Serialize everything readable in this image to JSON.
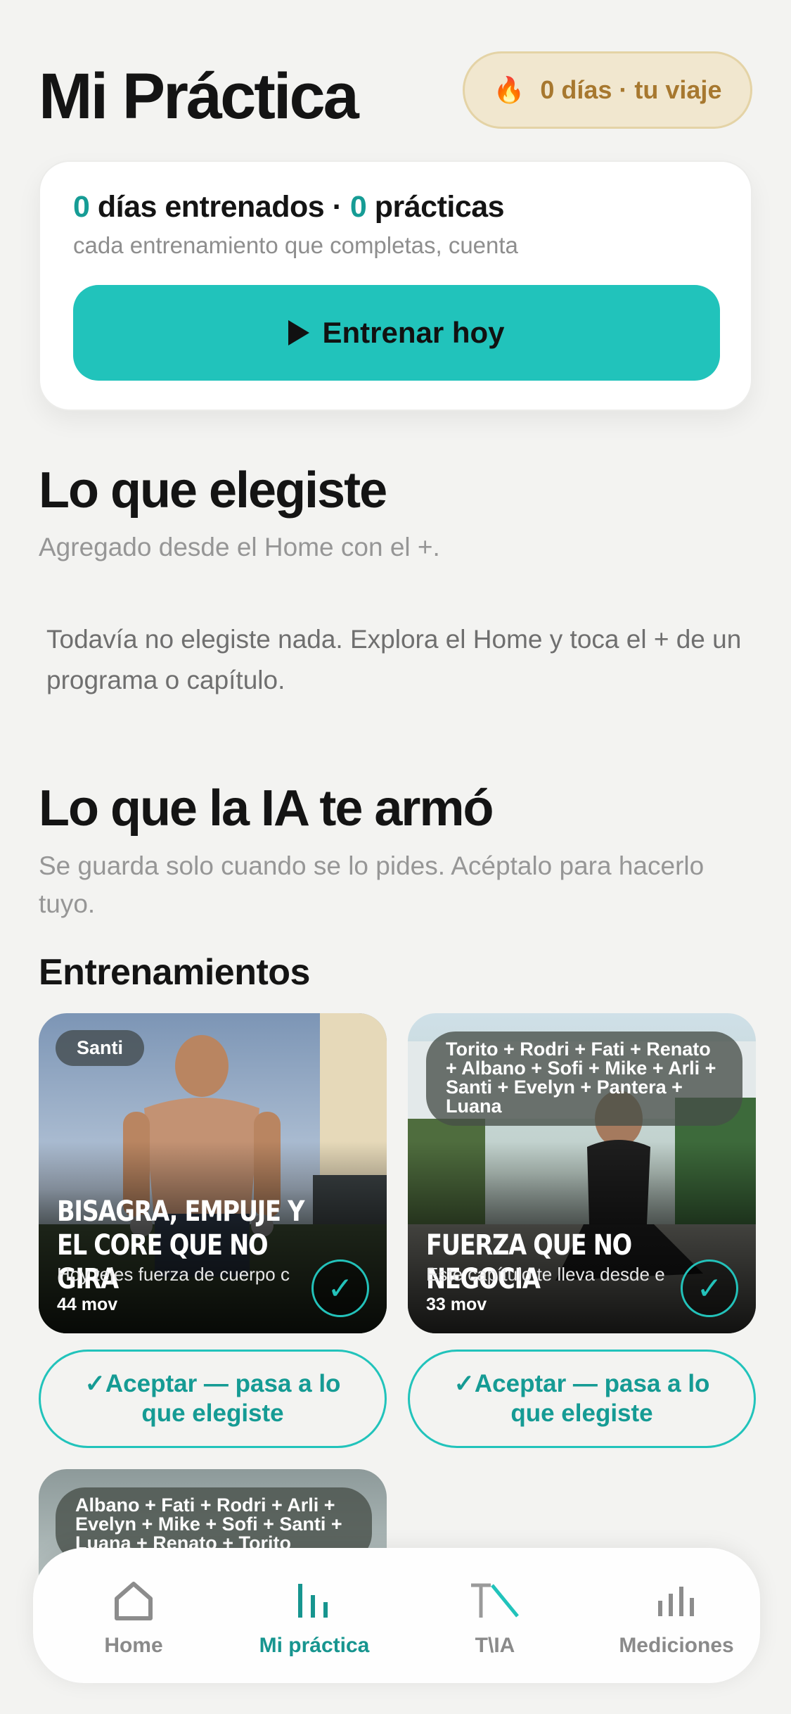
{
  "header": {
    "title": "Mi Práctica",
    "streak_label": "0 días · tu viaje",
    "streak_icon": "fire-icon"
  },
  "stats": {
    "days_count": "0",
    "days_label": "días entrenados · ",
    "practices_count": "0",
    "practices_label": "prácticas",
    "subtitle": "cada entrenamiento que completas, cuenta",
    "train_button": "Entrenar hoy"
  },
  "chosen": {
    "title": "Lo que elegiste",
    "subtitle": "Agregado desde el Home con el +.",
    "empty_message": "Todavía no elegiste nada. Explora el Home y toca el + de un programa o capítulo."
  },
  "ai": {
    "title": "Lo que la IA te armó",
    "subtitle": "Se guarda solo cuando se lo pides. Acéptalo para hacerlo tuyo.",
    "workouts_heading": "Entrenamientos",
    "workouts": [
      {
        "coach": "Santi",
        "title": "BISAGRA, EMPUJE Y EL CORE QUE NO GIRA",
        "description": "Hoy tejes fuerza de cuerpo c",
        "count": "44 mov",
        "accept_label": "✓Aceptar — pasa a lo que elegiste"
      },
      {
        "coach": "Torito + Rodri + Fati + Renato + Albano + Sofi + Mike + Arli + Santi + Evelyn + Pantera + Luana",
        "title": "FUERZA QUE NO NEGOCIA",
        "description": "Este capítulo te lleva desde e",
        "count": "33 mov",
        "accept_label": "✓Aceptar — pasa a lo que elegiste"
      },
      {
        "coach": "Albano + Fati + Rodri + Arli + Evelyn + Mike + Sofi + Santi + Luana + Renato + Torito"
      }
    ]
  },
  "nav": {
    "items": [
      {
        "label": "Home",
        "icon": "home-icon"
      },
      {
        "label": "Mi práctica",
        "icon": "bars-icon"
      },
      {
        "label": "T\\IA",
        "icon": "tia-icon"
      },
      {
        "label": "Mediciones",
        "icon": "chart-icon"
      }
    ],
    "active": "Mi práctica"
  },
  "colors": {
    "accent": "#21c3bb",
    "accent_dark": "#169c95",
    "streak_bg": "#f1e7cf",
    "streak_text": "#a7782f"
  }
}
